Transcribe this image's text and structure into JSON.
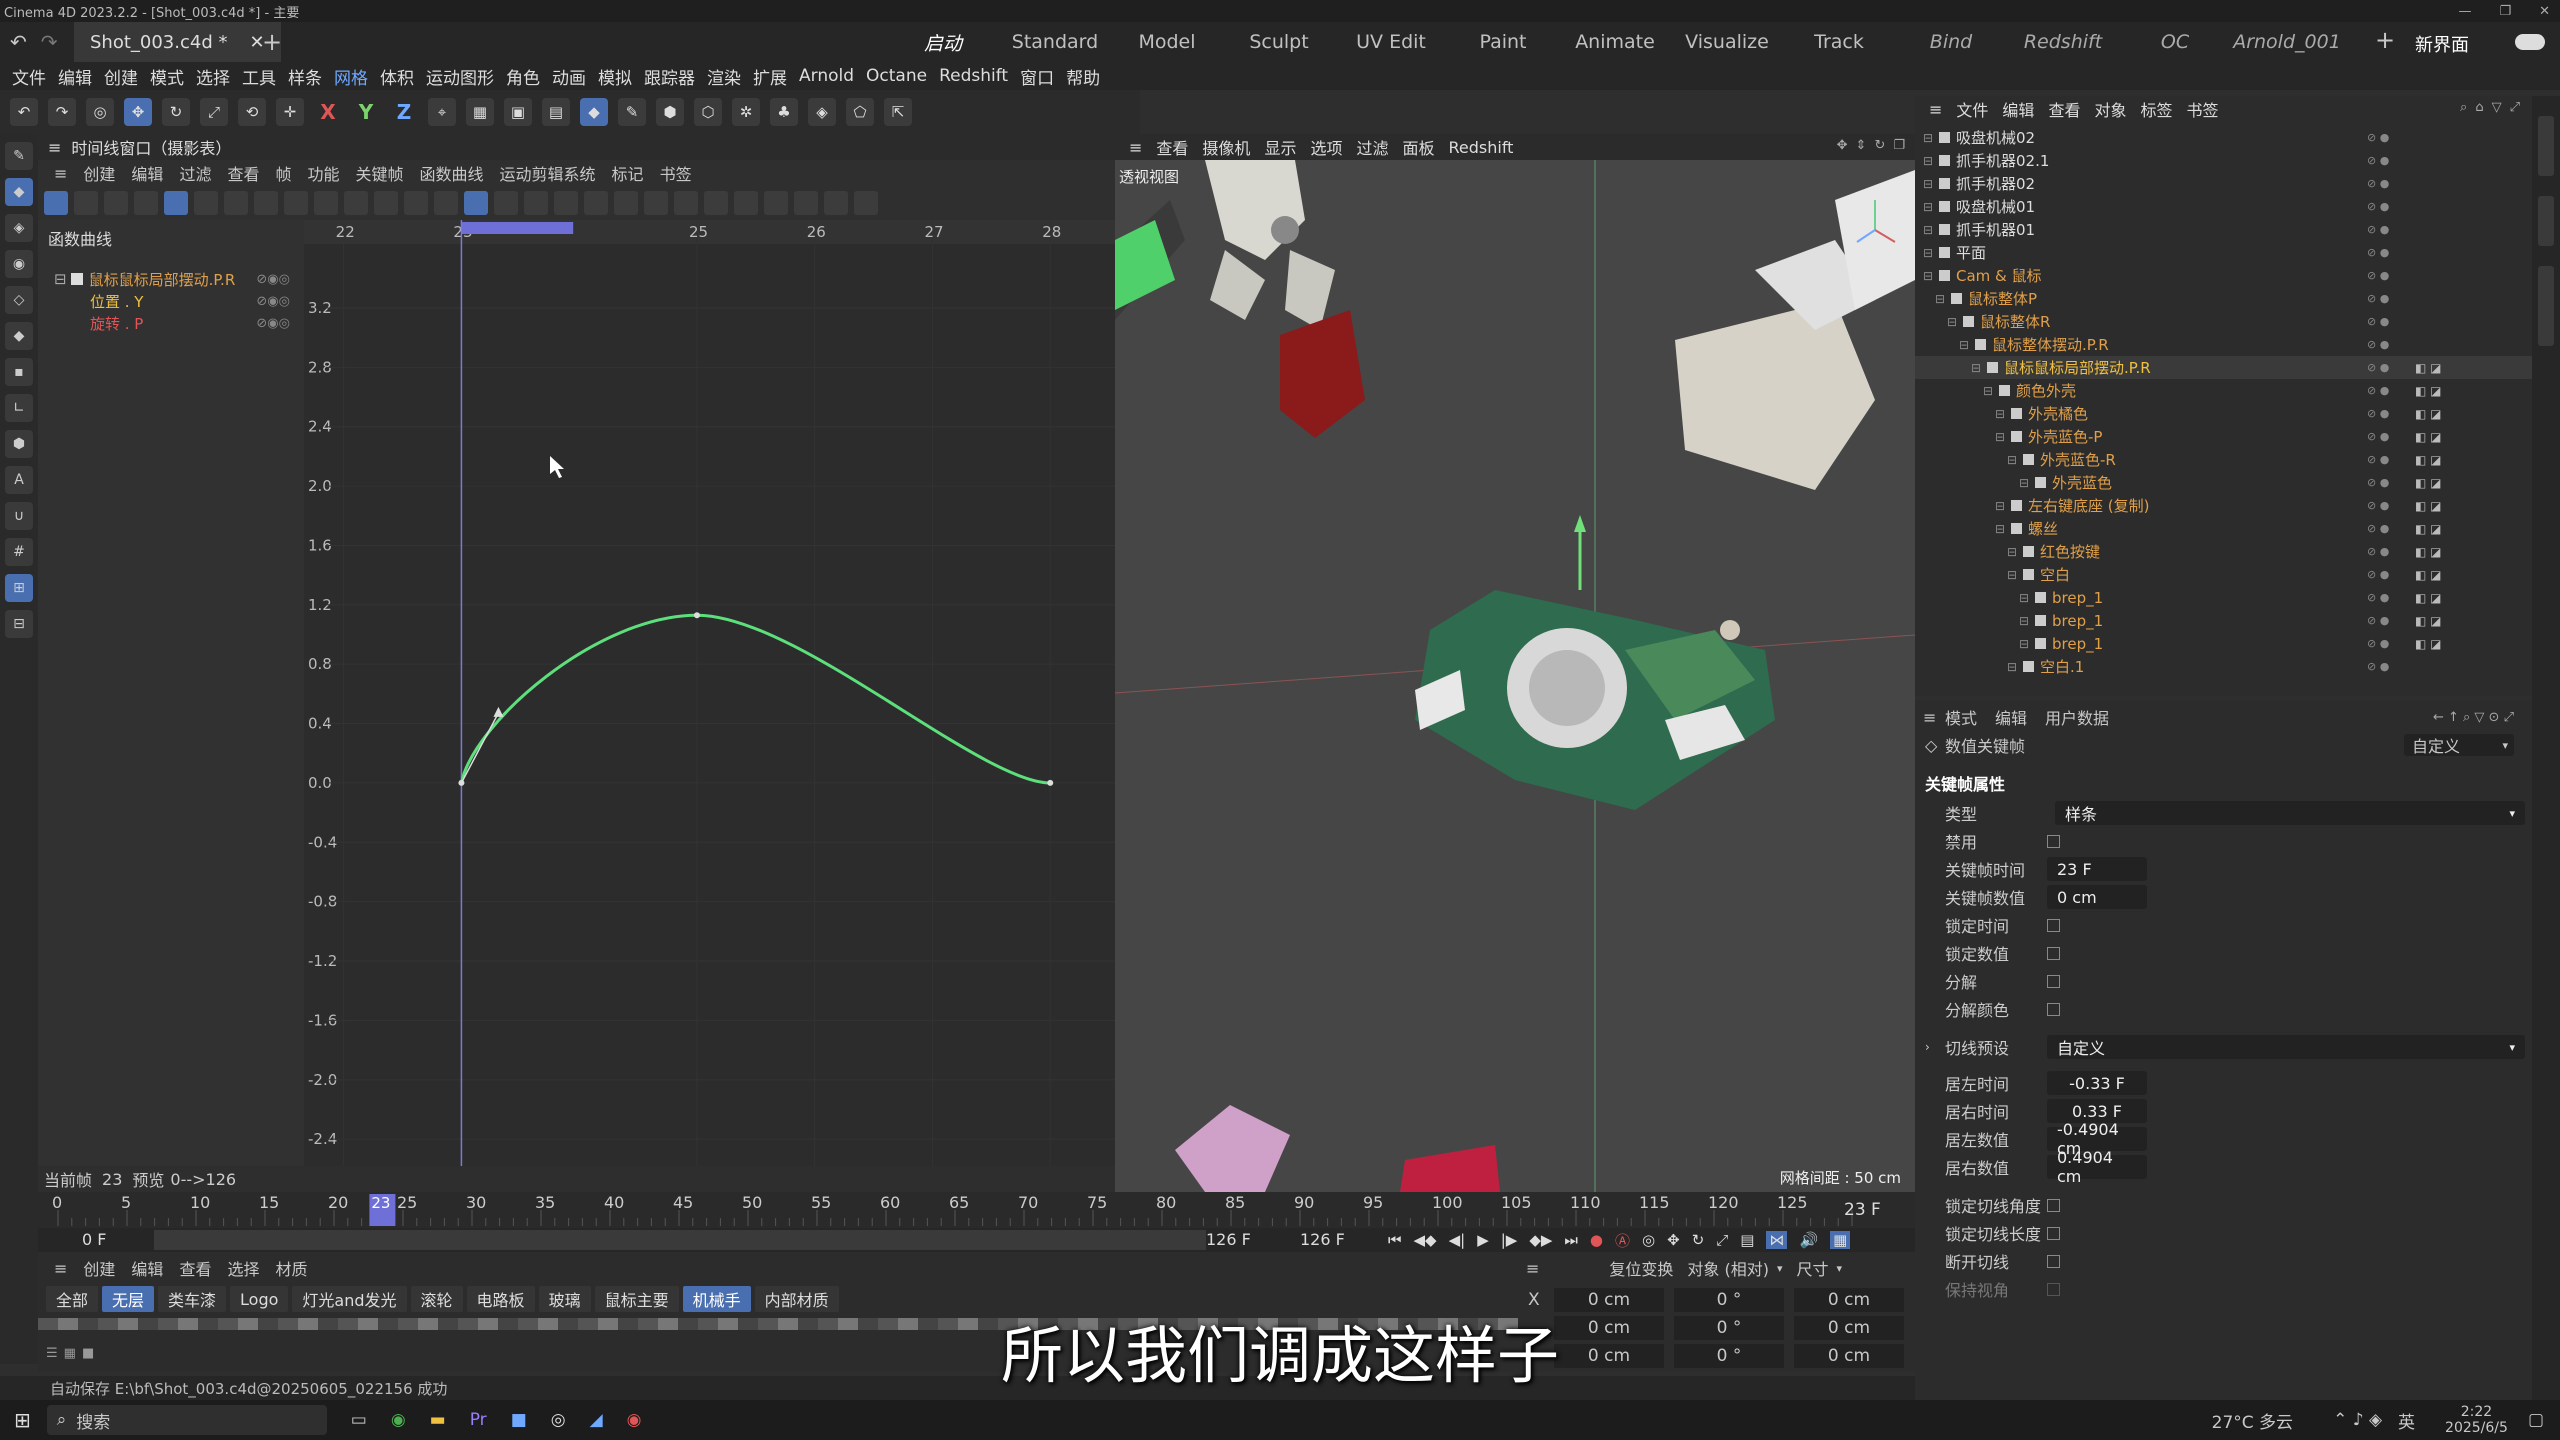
{
  "app": {
    "title": "Cinema 4D 2023.2.2 - [Shot_003.c4d *] - 主要"
  },
  "tabs": {
    "file": "Shot_003.c4d *"
  },
  "layouts": [
    "启动",
    "Standard",
    "Model",
    "Sculpt",
    "UV Edit",
    "Paint",
    "Animate",
    "Visualize",
    "Track",
    "Bind",
    "Redshift",
    "OC",
    "Arnold_001"
  ],
  "layout_new": "新界面",
  "menu": [
    "文件",
    "编辑",
    "创建",
    "模式",
    "选择",
    "工具",
    "样条",
    "网格",
    "体积",
    "运动图形",
    "角色",
    "动画",
    "模拟",
    "跟踪器",
    "渲染",
    "扩展",
    "Arnold",
    "Octane",
    "Redshift",
    "窗口",
    "帮助"
  ],
  "toolbar": {
    "x": "X",
    "y": "Y",
    "z": "Z"
  },
  "timeline": {
    "title": "时间线窗口（摄影表）",
    "menu": [
      "创建",
      "编辑",
      "过滤",
      "查看",
      "帧",
      "功能",
      "关键帧",
      "函数曲线",
      "运动剪辑系统",
      "标记",
      "书签"
    ],
    "mode_label": "函数曲线",
    "tracks": [
      "鼠标鼠标局部摆动.P.R",
      "位置 . Y",
      "旋转 . P"
    ],
    "frame_ticks": [
      "22",
      "23",
      "25",
      "26",
      "27",
      "28"
    ],
    "y_ticks": [
      "3.2",
      "2.8",
      "2.4",
      "2.0",
      "1.6",
      "1.2",
      "0.8",
      "0.4",
      "0.0",
      "-0.4",
      "-0.8",
      "-1.2",
      "-1.6",
      "-2.0",
      "-2.4"
    ],
    "status_current_label": "当前帧",
    "status_current": "23",
    "status_preview_label": "预览",
    "status_preview": "0-->126"
  },
  "curve": {
    "frames": [
      23,
      25,
      28
    ],
    "values": [
      0.0,
      1.13,
      0.0
    ]
  },
  "ruler": {
    "ticks": [
      "0",
      "5",
      "10",
      "15",
      "20",
      "25",
      "30",
      "35",
      "40",
      "45",
      "50",
      "55",
      "60",
      "65",
      "70",
      "75",
      "80",
      "85",
      "90",
      "95",
      "100",
      "105",
      "110",
      "115",
      "120",
      "125"
    ],
    "current": "23",
    "current_display": "23 F"
  },
  "range": {
    "start": "0 F",
    "start2": "0 F",
    "end": "126 F",
    "end2": "126 F"
  },
  "materials": {
    "menu": [
      "创建",
      "编辑",
      "查看",
      "选择",
      "材质"
    ],
    "tabs": [
      "全部",
      "无层",
      "类车漆",
      "Logo",
      "灯光and发光",
      "滚轮",
      "电路板",
      "玻璃",
      "鼠标主要",
      "机械手",
      "内部材质"
    ]
  },
  "viewport": {
    "menu": [
      "查看",
      "摄像机",
      "显示",
      "选项",
      "过滤",
      "面板",
      "Redshift"
    ],
    "label": "透视视图",
    "grid": "网格间距 : 50 cm"
  },
  "objects": {
    "menu": [
      "文件",
      "编辑",
      "查看",
      "对象",
      "标签",
      "书签"
    ],
    "items": [
      {
        "name": "吸盘机械02",
        "indent": 0,
        "color": "white"
      },
      {
        "name": "抓手机器02.1",
        "indent": 0,
        "color": "white"
      },
      {
        "name": "抓手机器02",
        "indent": 0,
        "color": "white"
      },
      {
        "name": "吸盘机械01",
        "indent": 0,
        "color": "white"
      },
      {
        "name": "抓手机器01",
        "indent": 0,
        "color": "white"
      },
      {
        "name": "平面",
        "indent": 0,
        "color": "white"
      },
      {
        "name": "Cam & 鼠标",
        "indent": 0,
        "color": "orange"
      },
      {
        "name": "鼠标整体P",
        "indent": 1,
        "color": "orange"
      },
      {
        "name": "鼠标整体R",
        "indent": 2,
        "color": "orange"
      },
      {
        "name": "鼠标整体摆动.P.R",
        "indent": 3,
        "color": "orange"
      },
      {
        "name": "鼠标鼠标局部摆动.P.R",
        "indent": 4,
        "color": "yellow"
      },
      {
        "name": "颜色外壳",
        "indent": 5,
        "color": "orange"
      },
      {
        "name": "外壳橘色",
        "indent": 6,
        "color": "orange"
      },
      {
        "name": "外壳蓝色-P",
        "indent": 6,
        "color": "orange"
      },
      {
        "name": "外壳蓝色-R",
        "indent": 7,
        "color": "orange"
      },
      {
        "name": "外壳蓝色",
        "indent": 8,
        "color": "orange"
      },
      {
        "name": "左右键底座 (复制)",
        "indent": 6,
        "color": "orange"
      },
      {
        "name": "螺丝",
        "indent": 6,
        "color": "orange"
      },
      {
        "name": "红色按键",
        "indent": 7,
        "color": "orange"
      },
      {
        "name": "空白",
        "indent": 7,
        "color": "orange"
      },
      {
        "name": "brep_1",
        "indent": 8,
        "color": "orange"
      },
      {
        "name": "brep_1",
        "indent": 8,
        "color": "orange"
      },
      {
        "name": "brep_1",
        "indent": 8,
        "color": "orange"
      },
      {
        "name": "空白.1",
        "indent": 7,
        "color": "orange"
      }
    ]
  },
  "attributes": {
    "menu": [
      "模式",
      "编辑",
      "用户数据"
    ],
    "section": "数值关键帧",
    "preset": "自定义",
    "group": "关键帧属性",
    "type_label": "类型",
    "type_value": "样条",
    "disable_label": "禁用",
    "time_label": "关键帧时间",
    "time_value": "23 F",
    "value_label": "关键帧数值",
    "value_value": "0 cm",
    "lock_time": "锁定时间",
    "lock_value": "锁定数值",
    "break": "分解",
    "break_color": "分解颜色",
    "tangent_preset_label": "切线预设",
    "tangent_preset_value": "自定义",
    "left_time_label": "居左时间",
    "left_time": "-0.33 F",
    "right_time_label": "居右时间",
    "right_time": "0.33 F",
    "left_value_label": "居左数值",
    "left_value": "-0.4904 cm",
    "right_value_label": "居右数值",
    "right_value": "0.4904 cm",
    "lock_angle": "锁定切线角度",
    "lock_length": "锁定切线长度",
    "break_tangent": "断开切线",
    "keep_visual": "保持视角"
  },
  "coords": {
    "reset": "复位变换",
    "mode": "对象 (相对)",
    "size": "尺寸",
    "rows": [
      [
        "X",
        "0 cm",
        "0 °",
        "0 cm"
      ],
      [
        "",
        "0 cm",
        "0 °",
        "0 cm"
      ],
      [
        "",
        "0 cm",
        "0 °",
        "0 cm"
      ]
    ]
  },
  "status_message": "自动保存 E:\\bf\\Shot_003.c4d@20250605_022156 成功",
  "subtitle": "所以我们调成这样子",
  "taskbar": {
    "search": "搜索",
    "weather": "27°C 多云",
    "ime": "英",
    "time": "2:22",
    "date": "2025/6/5"
  },
  "colors": {
    "curve": "#5de07c",
    "accent": "#4a6fb0",
    "playhead": "#6f6fd8"
  }
}
